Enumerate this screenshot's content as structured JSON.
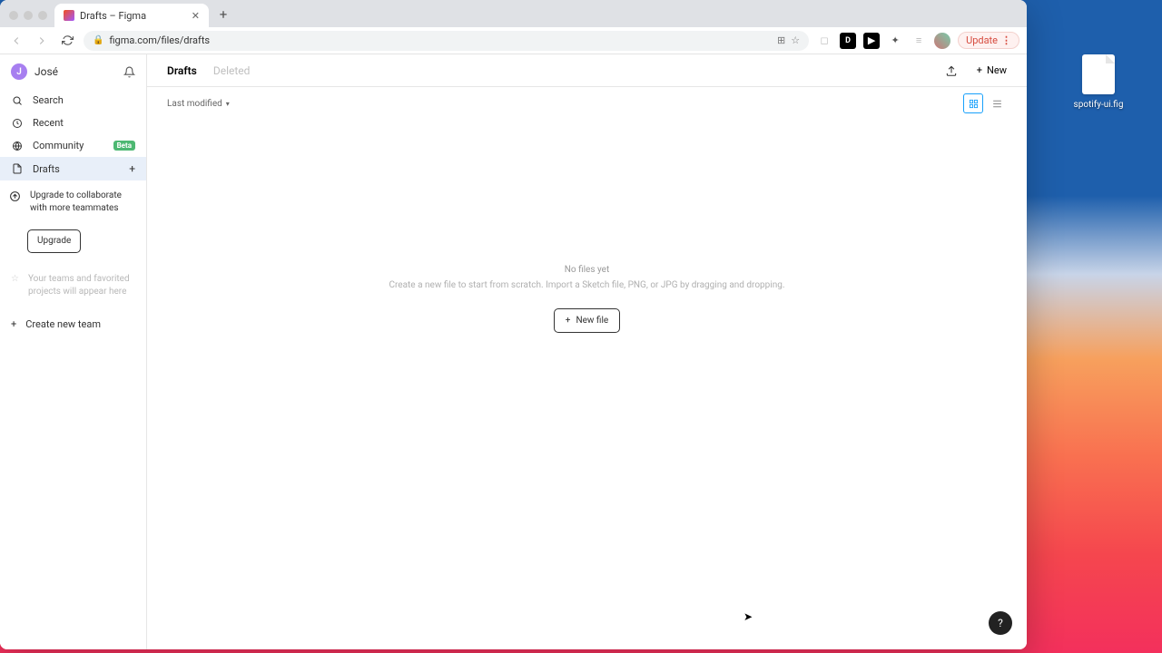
{
  "desktop": {
    "file_label": "spotify-ui.fig"
  },
  "browser": {
    "tab_title": "Drafts – Figma",
    "url": "figma.com/files/drafts",
    "update_label": "Update"
  },
  "sidebar": {
    "user_name": "José",
    "user_initial": "J",
    "items": [
      {
        "label": "Search"
      },
      {
        "label": "Recent"
      },
      {
        "label": "Community",
        "badge": "Beta"
      },
      {
        "label": "Drafts"
      }
    ],
    "upgrade_text": "Upgrade to collaborate with more teammates",
    "upgrade_button": "Upgrade",
    "hint_text": "Your teams and favorited projects will appear here",
    "create_team": "Create new team"
  },
  "main": {
    "tabs": {
      "drafts": "Drafts",
      "deleted": "Deleted"
    },
    "new_label": "New",
    "sort_label": "Last modified",
    "empty_title": "No files yet",
    "empty_sub": "Create a new file to start from scratch. Import a Sketch file, PNG, or JPG by dragging and dropping.",
    "new_file_label": "New file"
  },
  "help": "?"
}
